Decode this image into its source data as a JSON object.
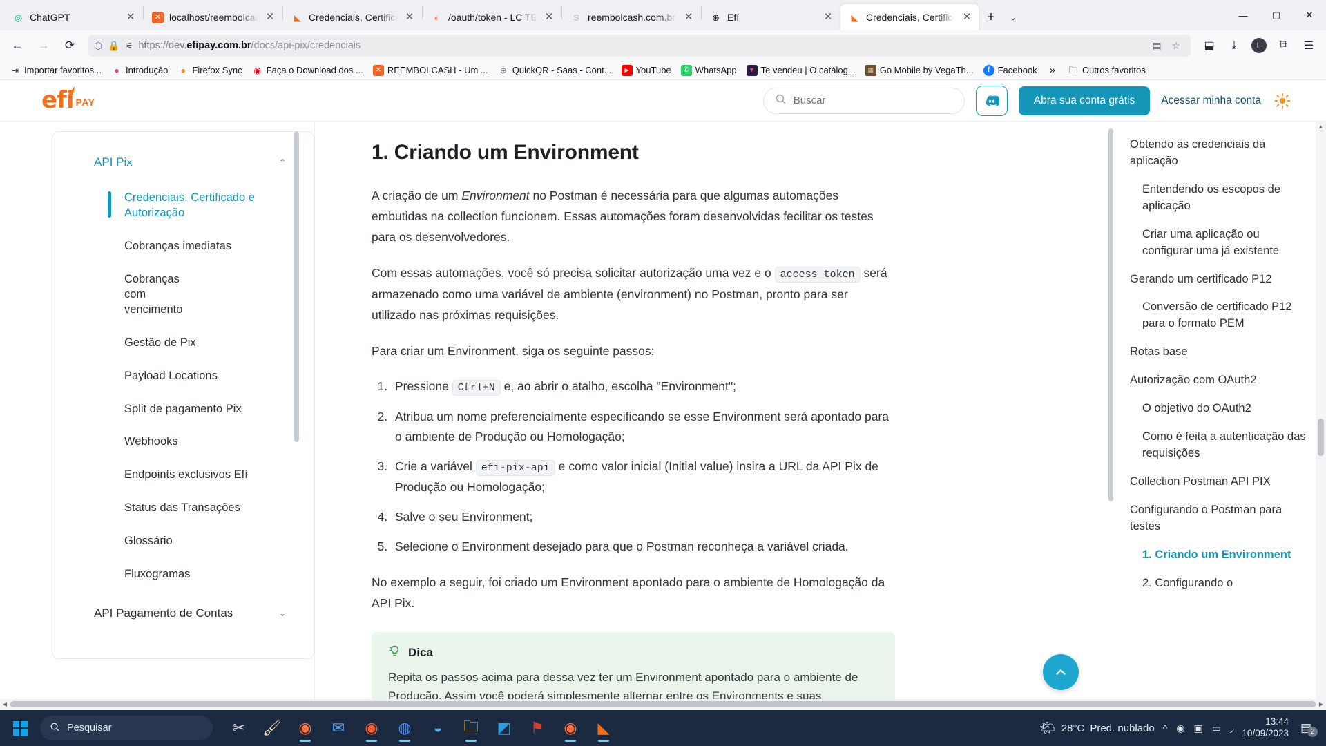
{
  "browser": {
    "tabs": [
      {
        "title": "ChatGPT",
        "icon": "chatgpt-icon",
        "icon_glyph": "◎",
        "icon_color": "#10a37f",
        "active": false
      },
      {
        "title": "localhost/reembolcash/",
        "icon": "reembolcash-icon",
        "icon_glyph": "✕",
        "icon_color": "#f26522",
        "active": false
      },
      {
        "title": "Credenciais, Certificado",
        "icon": "efi-icon",
        "icon_glyph": "◣",
        "icon_color": "#f3701a",
        "active": false
      },
      {
        "title": "/oauth/token - LC TECH",
        "icon": "lctech-icon",
        "icon_glyph": "◐",
        "icon_color": "#fa6338",
        "active": false
      },
      {
        "title": "reembolcash.com.br/int",
        "icon": "s-icon",
        "icon_glyph": "S",
        "icon_color": "#c8c8d0",
        "active": false
      },
      {
        "title": "Efí",
        "icon": "globe-icon",
        "icon_glyph": "⊕",
        "icon_color": "#15141a",
        "active": false
      },
      {
        "title": "Credenciais, Certificade",
        "icon": "efi-icon",
        "icon_glyph": "◣",
        "icon_color": "#f3701a",
        "active": true
      }
    ],
    "new_tab_label": "+",
    "list_tabs_label": "⌄",
    "window_controls": {
      "minimize": "—",
      "maximize": "▢",
      "close": "✕"
    },
    "nav": {
      "back": "←",
      "forward": "→",
      "reload": "⟳",
      "url_prefix": "https://dev.",
      "url_domain": "efipay.com.br",
      "url_path": "/docs/api-pix/credenciais",
      "shield_icon": "⬡",
      "lock_icon": "🔒",
      "perm_icon": "⚙",
      "reader_icon": "▤",
      "bookmark_icon": "☆",
      "pocket_icon": "⬓",
      "download_icon": "⤓",
      "account_icon": "L",
      "extensions_icon": "⧉",
      "menu_icon": "☰"
    },
    "bookmarks": [
      {
        "label": "Importar favoritos...",
        "icon": "import-icon",
        "glyph": "⇥",
        "color": "#15141a"
      },
      {
        "label": "Introdução",
        "icon": "firefox-icon",
        "glyph": "●",
        "color": "#d8408a"
      },
      {
        "label": "Firefox Sync",
        "icon": "firefox-sync-icon",
        "glyph": "●",
        "color": "#f08a1c"
      },
      {
        "label": "Faça o Download dos ...",
        "icon": "mastercard-icon",
        "glyph": "◉",
        "color": "#eb001b"
      },
      {
        "label": "REEMBOLCASH - Um ...",
        "icon": "reembolcash-icon",
        "glyph": "✕",
        "color": "#f26522"
      },
      {
        "label": "QuickQR - Saas - Cont...",
        "icon": "globe-icon",
        "glyph": "⊕",
        "color": "#4b5563"
      },
      {
        "label": "YouTube",
        "icon": "youtube-icon",
        "glyph": "▶",
        "color": "#ff0000"
      },
      {
        "label": "WhatsApp",
        "icon": "whatsapp-icon",
        "glyph": "✆",
        "color": "#25d366"
      },
      {
        "label": "Te vendeu | O catálog...",
        "icon": "vendeu-icon",
        "glyph": "▼",
        "color": "#f04b4b"
      },
      {
        "label": "Go Mobile by VegaTh...",
        "icon": "gomobile-icon",
        "glyph": "▦",
        "color": "#8b6b4a"
      },
      {
        "label": "Facebook",
        "icon": "facebook-icon",
        "glyph": "f",
        "color": "#1877f2"
      }
    ],
    "bookmarks_overflow": "»",
    "other_bookmarks": {
      "label": "Outros favoritos",
      "icon": "folder-icon",
      "glyph": "🗀"
    }
  },
  "site": {
    "logo": {
      "name": "efi",
      "suffix": "PAY"
    },
    "search": {
      "placeholder": "Buscar",
      "value": "",
      "icon": "search-icon"
    },
    "discord_icon": "discord-icon",
    "cta_label": "Abra sua conta grátis",
    "login_label": "Acessar minha conta",
    "theme_toggle_icon": "sun-icon"
  },
  "sidebar": {
    "groups": [
      {
        "title": "API Pix",
        "expanded": true,
        "chevron": "⌃",
        "items": [
          {
            "label": "Credenciais, Certificado e Autorização",
            "active": true
          },
          {
            "label": "Cobranças imediatas",
            "active": false
          },
          {
            "label": "Cobranças com vencimento",
            "active": false
          },
          {
            "label": "Gestão de Pix",
            "active": false
          },
          {
            "label": "Payload Locations",
            "active": false
          },
          {
            "label": "Split de pagamento Pix",
            "active": false
          },
          {
            "label": "Webhooks",
            "active": false
          },
          {
            "label": "Endpoints exclusivos Efí",
            "active": false
          },
          {
            "label": "Status das Transações",
            "active": false
          },
          {
            "label": "Glossário",
            "active": false
          },
          {
            "label": "Fluxogramas",
            "active": false
          }
        ]
      },
      {
        "title": "API Pagamento de Contas",
        "expanded": false,
        "chevron": "⌄",
        "items": []
      }
    ]
  },
  "main": {
    "heading": "1. Criando um Environment",
    "paragraph_1": {
      "part_a": "A criação de um ",
      "em_1": "Environment",
      "part_b": " no Postman é necessária para que algumas automações embutidas na collection funcionem. Essas automações foram desenvolvidas fecilitar os testes para os desenvolvedores."
    },
    "paragraph_2": {
      "part_a": "Com essas automações, você só precisa solicitar autorização uma vez e o ",
      "code_1": "access_token",
      "part_b": " será armazenado como uma variável de ambiente (environment) no Postman, pronto para ser utilizado nas próximas requisições."
    },
    "paragraph_3": "Para criar um Environment, siga os seguinte passos:",
    "steps": [
      {
        "part_a": "Pressione ",
        "code": "Ctrl+N",
        "part_b": " e, ao abrir o atalho, escolha \"Environment\";"
      },
      {
        "part_a": "Atribua um nome preferencialmente especificando se esse Environment será apontado para o ambiente de Produção ou Homologação;",
        "code": "",
        "part_b": ""
      },
      {
        "part_a": "Crie a variável ",
        "code": "efi-pix-api",
        "part_b": " e como valor inicial (Initial value) insira a URL da API Pix de Produção ou Homologação;",
        "em": "Initial value"
      },
      {
        "part_a": "Salve o seu Environment;",
        "code": "",
        "part_b": ""
      },
      {
        "part_a": "Selecione o Environment desejado para que o Postman reconheça a variável criada.",
        "code": "",
        "part_b": ""
      }
    ],
    "paragraph_4": "No exemplo a seguir, foi criado um Environment apontado para o ambiente de Homologação da API Pix.",
    "tip": {
      "icon": "lightbulb-icon",
      "title": "Dica",
      "body": "Repita os passos acima para dessa vez ter um Environment apontado para o ambiente de Produção. Assim você poderá simplesmente alternar entre os Environments e suas requisições já estarão apontadas corretamente."
    },
    "scroll_top_icon": "chevron-up-icon"
  },
  "toc": {
    "items": [
      {
        "label": "Obtendo as credenciais da aplicação",
        "level": 1,
        "active": false
      },
      {
        "label": "Entendendo os escopos de aplicação",
        "level": 2,
        "active": false
      },
      {
        "label": "Criar uma aplicação ou configurar uma já existente",
        "level": 2,
        "active": false
      },
      {
        "label": "Gerando um certificado P12",
        "level": 1,
        "active": false
      },
      {
        "label": "Conversão de certificado P12 para o formato PEM",
        "level": 2,
        "active": false
      },
      {
        "label": "Rotas base",
        "level": 1,
        "active": false
      },
      {
        "label": "Autorização com OAuth2",
        "level": 1,
        "active": false
      },
      {
        "label": "O objetivo do OAuth2",
        "level": 2,
        "active": false
      },
      {
        "label": "Como é feita a autenticação das requisições",
        "level": 2,
        "active": false
      },
      {
        "label": "Collection Postman API PIX",
        "level": 1,
        "active": false
      },
      {
        "label": "Configurando o Postman para testes",
        "level": 1,
        "active": false
      },
      {
        "label": "1. Criando um Environment",
        "level": 2,
        "active": true
      },
      {
        "label": "2. Configurando o",
        "level": 2,
        "active": false
      }
    ]
  },
  "taskbar": {
    "search_placeholder": "Pesquisar",
    "search_icon": "search-icon",
    "start_icon": "windows-icon",
    "apps": [
      {
        "name": "snip-tool-icon",
        "glyph": "✂",
        "color": "#e8e8e8",
        "running": false
      },
      {
        "name": "paint-icon",
        "glyph": "🖌",
        "color": "#f0f0f0",
        "running": false
      },
      {
        "name": "firefox-icon",
        "glyph": "◉",
        "color": "#ff7139",
        "running": true
      },
      {
        "name": "mail-icon",
        "glyph": "✉",
        "color": "#3b82f6",
        "running": false
      },
      {
        "name": "firefox-dev-icon",
        "glyph": "◉",
        "color": "#ff5c2b",
        "running": true
      },
      {
        "name": "chrome-icon",
        "glyph": "◍",
        "color": "#4285f4",
        "running": true
      },
      {
        "name": "edge-icon",
        "glyph": "◒",
        "color": "#30a0d8",
        "running": false
      },
      {
        "name": "file-explorer-icon",
        "glyph": "🗀",
        "color": "#f0b429",
        "running": true
      },
      {
        "name": "vscode-icon",
        "glyph": "◩",
        "color": "#2b9fe0",
        "running": false
      },
      {
        "name": "filezilla-icon",
        "glyph": "⚑",
        "color": "#c0392b",
        "running": false
      },
      {
        "name": "postman-icon",
        "glyph": "◉",
        "color": "#ff6c37",
        "running": true
      },
      {
        "name": "app-icon",
        "glyph": "◣",
        "color": "#f3701a",
        "running": true
      }
    ],
    "weather": {
      "temp": "28°C",
      "condition": "Pred. nublado",
      "icon": "partly-cloudy-icon"
    },
    "tray": [
      {
        "name": "show-hidden-icons",
        "glyph": "^"
      },
      {
        "name": "record-icon",
        "glyph": "◉"
      },
      {
        "name": "camera-icon",
        "glyph": "▣"
      },
      {
        "name": "battery-icon",
        "glyph": "▭"
      },
      {
        "name": "wifi-icon",
        "glyph": "◞"
      }
    ],
    "time": "13:44",
    "date": "10/09/2023",
    "notifications": {
      "icon": "notification-icon",
      "count": "2"
    }
  }
}
